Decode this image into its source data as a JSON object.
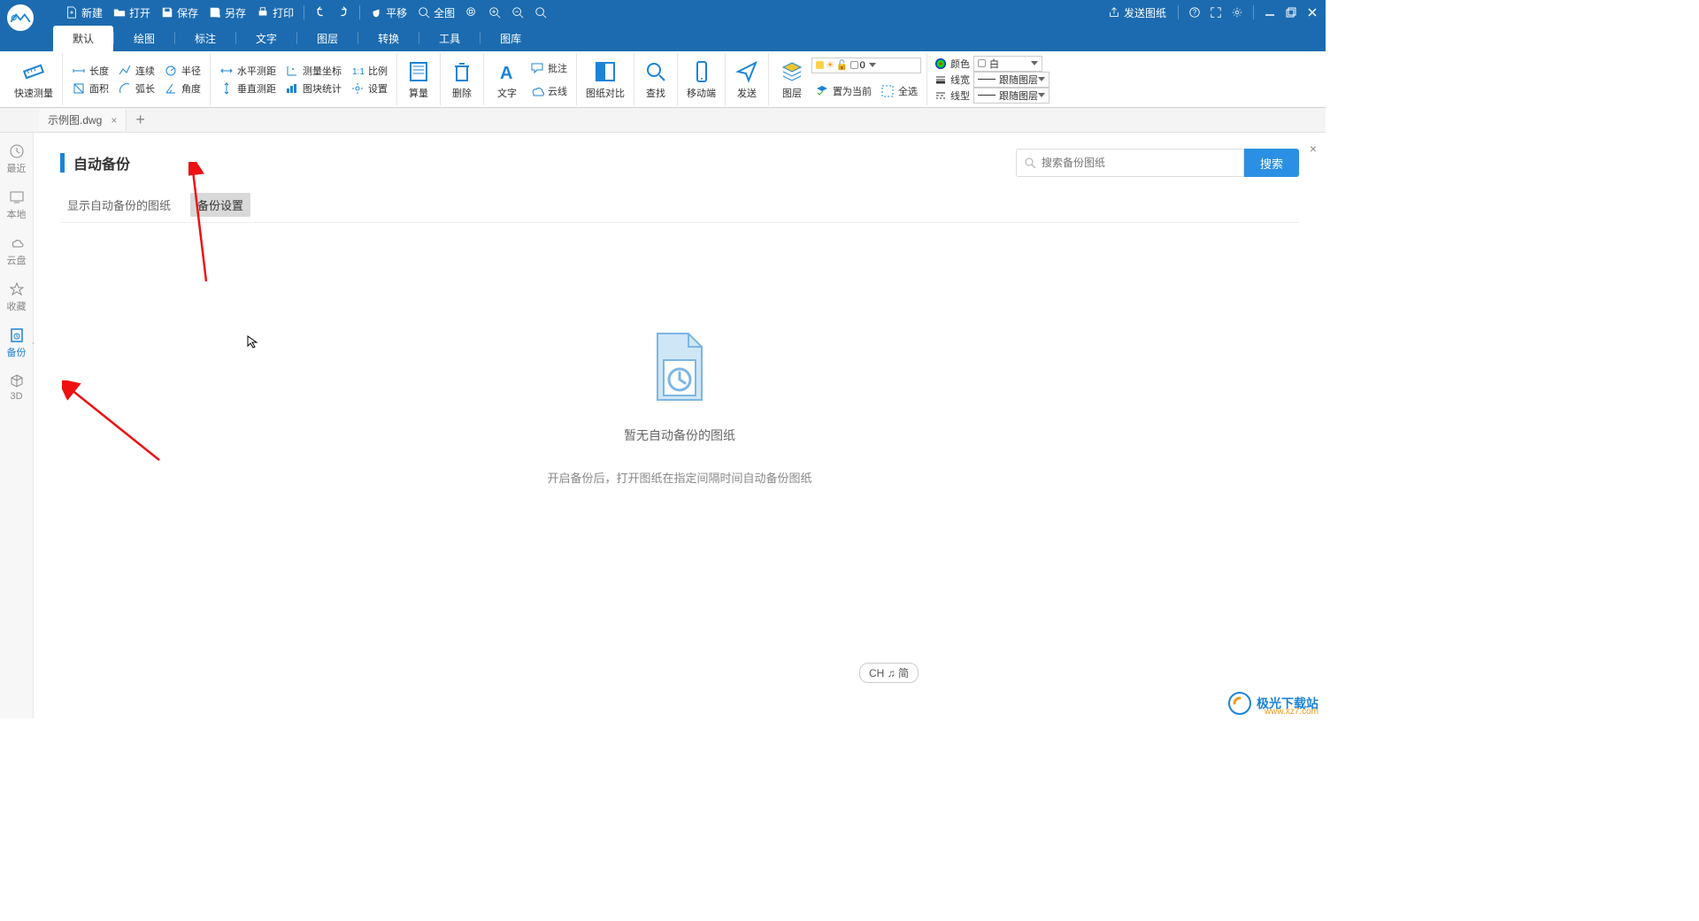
{
  "titlebar": {
    "new": "新建",
    "open": "打开",
    "save": "保存",
    "saveas": "另存",
    "print": "打印",
    "pan": "平移",
    "full": "全图",
    "send": "发送图纸"
  },
  "menus": [
    "默认",
    "绘图",
    "标注",
    "文字",
    "图层",
    "转换",
    "工具",
    "图库"
  ],
  "ribbon": {
    "quick": "快速测量",
    "r1": [
      "长度",
      "连续",
      "半径",
      "水平测距",
      "测量坐标",
      "比例"
    ],
    "r2": [
      "面积",
      "弧长",
      "角度",
      "垂直测距",
      "图块统计",
      "设置"
    ],
    "calc": "算量",
    "del": "删除",
    "text": "文字",
    "pizhu": "批注",
    "cloud": "云线",
    "compare": "图纸对比",
    "find": "查找",
    "mobile": "移动端",
    "send": "发送",
    "layer": "图层",
    "curlayer": "置为当前",
    "selall": "全选",
    "color": "颜色",
    "colorval": "白",
    "lw": "线宽",
    "lwval": "跟随图层",
    "lt": "线型",
    "ltval": "跟随图层",
    "layernum": "0"
  },
  "filetab": {
    "name": "示例图.dwg"
  },
  "sidebar": [
    "最近",
    "本地",
    "云盘",
    "收藏",
    "备份",
    "3D"
  ],
  "page": {
    "title": "自动备份",
    "tab1": "显示自动备份的图纸",
    "tab2": "备份设置",
    "search_ph": "搜索备份图纸",
    "search_btn": "搜索",
    "empty1": "暂无自动备份的图纸",
    "empty2": "开启备份后，打开图纸在指定间隔时间自动备份图纸"
  },
  "ime": "CH ♫ 简",
  "watermark": {
    "name": "极光下载站",
    "url": "www.xz7.com"
  }
}
